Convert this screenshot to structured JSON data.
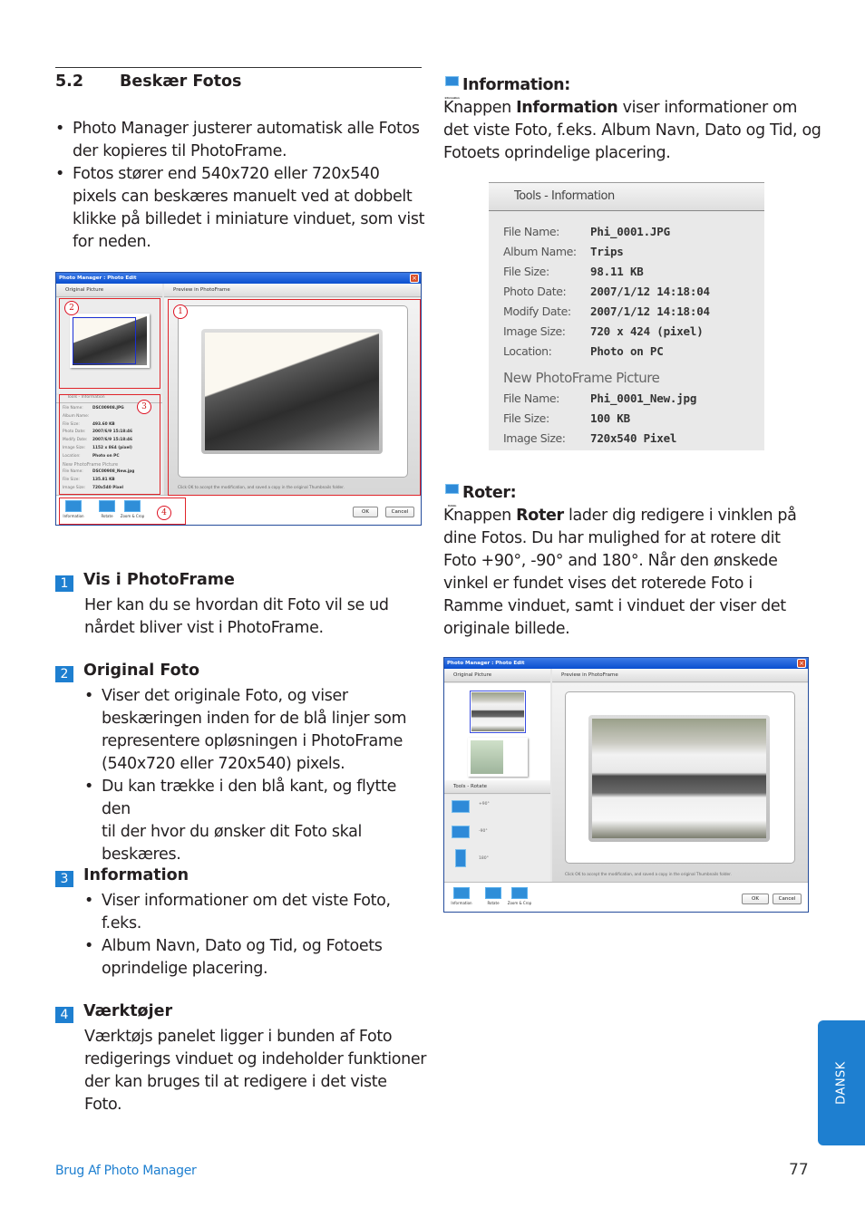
{
  "section": {
    "number": "5.2",
    "title": "Beskær Fotos"
  },
  "intro_bullets": [
    [
      "Photo Manager justerer automatisk alle Fotos",
      "der kopieres til PhotoFrame."
    ],
    [
      "Fotos stører end 540x720 eller 720x540",
      "pixels can beskæres manuelt ved at dobbelt",
      "klikke på billedet i miniature vinduet, som vist",
      "for neden."
    ]
  ],
  "dialog1": {
    "title": "Photo Manager : Photo Edit",
    "left_pane_title": "Original Picture",
    "right_pane_title": "Preview in PhotoFrame",
    "info_pane_title": "Tools - Information",
    "info_rows": [
      {
        "k": "File Name:",
        "v": "DSC00908.JPG"
      },
      {
        "k": "Album Name:",
        "v": ""
      },
      {
        "k": "File Size:",
        "v": "493.60 KB"
      },
      {
        "k": "Photo Date:",
        "v": "2007/6/9 15:18:46"
      },
      {
        "k": "Modify Date:",
        "v": "2007/6/9 15:18:46"
      },
      {
        "k": "Image Size:",
        "v": "1152 x 864 (pixel)"
      },
      {
        "k": "Location:",
        "v": "Photo on PC"
      }
    ],
    "new_title": "New PhotoFrame Picture",
    "new_rows": [
      {
        "k": "File Name:",
        "v": "DSC00908_New.jpg"
      },
      {
        "k": "File Size:",
        "v": "135.81 KB"
      },
      {
        "k": "Image Size:",
        "v": "720x540 Pixel"
      }
    ],
    "hint": "Click OK to accept the modification, and saved a copy in the original Thumbnails folder.",
    "tools": [
      "Information",
      "Rotate",
      "Zoom & Crop"
    ],
    "ok": "OK",
    "cancel": "Cancel",
    "callouts": [
      "1",
      "2",
      "3",
      "4"
    ]
  },
  "items": [
    {
      "num": "1",
      "title": "Vis i PhotoFrame",
      "lines": [
        "Her kan du se hvordan dit Foto vil se ud",
        "nårdet bliver vist i PhotoFrame."
      ]
    },
    {
      "num": "2",
      "title": "Original Foto",
      "bullets": [
        [
          "Viser det originale Foto, og viser",
          "beskæringen inden for de blå linjer som",
          "representere opløsningen i PhotoFrame",
          "(540x720 eller 720x540) pixels."
        ],
        [
          "Du kan trække i den blå kant, og flytte den",
          "til der hvor du ønsker dit Foto skal",
          "beskæres."
        ]
      ]
    },
    {
      "num": "3",
      "title": "Information",
      "bullets": [
        [
          "Viser informationer om det viste Foto,",
          "f.eks."
        ],
        [
          "Album Navn, Dato og Tid, og Fotoets",
          "oprindelige placering."
        ]
      ]
    },
    {
      "num": "4",
      "title": "Værktøjer",
      "lines": [
        "Værktøjs panelet ligger i bunden af Foto",
        "redigerings vinduet og indeholder funktioner",
        "der kan bruges til at redigere i det viste",
        "Foto."
      ]
    }
  ],
  "information_section": {
    "icon_caption": "Information",
    "heading": "Information:",
    "body_pre": "Knappen ",
    "body_bold": "Information",
    "body_post": " viser informationer om",
    "lines": [
      "det viste Foto, f.eks. Album Navn, Dato og Tid, og",
      "Fotoets oprindelige placering."
    ]
  },
  "info_panel": {
    "title": "Tools - Information",
    "rows": [
      {
        "k": "File Name:",
        "v": "Phi_0001.JPG"
      },
      {
        "k": "Album Name:",
        "v": "Trips"
      },
      {
        "k": "File Size:",
        "v": "98.11 KB"
      },
      {
        "k": "Photo Date:",
        "v": "2007/1/12 14:18:04"
      },
      {
        "k": "Modify Date:",
        "v": "2007/1/12 14:18:04"
      },
      {
        "k": "Image Size:",
        "v": "720 x 424 (pixel)"
      },
      {
        "k": "Location:",
        "v": "Photo on PC"
      }
    ],
    "new_title": "New PhotoFrame Picture",
    "new_rows": [
      {
        "k": "File Name:",
        "v": "Phi_0001_New.jpg"
      },
      {
        "k": "File Size:",
        "v": "100 KB"
      },
      {
        "k": "Image Size:",
        "v": "720x540 Pixel"
      }
    ]
  },
  "rotate_section": {
    "icon_caption": "Rotate",
    "heading": "Roter:",
    "body_pre": "Knappen ",
    "body_bold": "Roter",
    "body_post": " lader dig redigere i vinklen på",
    "lines": [
      "dine Fotos. Du har mulighed for at rotere dit",
      "Foto +90°, -90° and 180°. Når den ønskede",
      "vinkel er fundet vises det roterede Foto i",
      "Ramme vinduet, samt i vinduet der viser det",
      "originale billede."
    ]
  },
  "dialog2": {
    "title": "Photo Manager : Photo Edit",
    "left_pane_title": "Original Picture",
    "right_pane_title": "Preview in PhotoFrame",
    "rotate_pane_title": "Tools - Rotate",
    "rotate_options": [
      "+90°",
      "-90°",
      "180°"
    ],
    "hint": "Click OK to accept the modification, and saved a copy in the original Thumbnails folder.",
    "tools": [
      "Information",
      "Rotate",
      "Zoom & Crop"
    ],
    "ok": "OK",
    "cancel": "Cancel"
  },
  "side_tab": "DANSK",
  "footer": {
    "left": "Brug Af Photo Manager",
    "page": "77"
  },
  "colors": {
    "accent": "#1e7fd0",
    "callout_red": "#e0242a",
    "crop_blue": "#1a2fd6"
  }
}
